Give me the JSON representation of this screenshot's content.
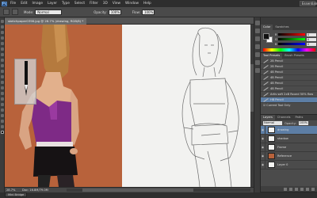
{
  "menubar": {
    "logo": "Ps",
    "items": [
      "File",
      "Edit",
      "Image",
      "Layer",
      "Type",
      "Select",
      "Filter",
      "3D",
      "View",
      "Window",
      "Help"
    ],
    "workspace": "Essentials"
  },
  "options": {
    "mode_label": "Mode:",
    "mode_value": "Normal",
    "opacity_label": "Opacity:",
    "opacity_value": "100%",
    "flow_label": "Flow:",
    "flow_value": "100%"
  },
  "document": {
    "tab_title": "sketchpaper0398.jpg @ 28.7% (drawing, RGB/8) *"
  },
  "status": {
    "zoom": "28.7%",
    "doc_info": "Doc: 16.8M/79.0M"
  },
  "bottom": {
    "mini_bridge": "Mini Bridge"
  },
  "color_panel": {
    "tabs": [
      "Color",
      "Swatches"
    ],
    "sliders": [
      {
        "label": "R",
        "value": "0"
      },
      {
        "label": "G",
        "value": "0"
      },
      {
        "label": "B",
        "value": "0"
      }
    ],
    "colors": {
      "foreground": "#111111",
      "background": "#ffffff"
    }
  },
  "presets_panel": {
    "tabs": [
      "Tool Presets",
      "Brush Presets"
    ],
    "items": [
      "2B Pencil",
      "2B Pencil",
      "4B Pencil",
      "4B Pencil",
      "4B Pencil",
      "4B Pencil",
      "Artis soft 2xB Round 50% flow",
      "HB Pencil"
    ],
    "selected_index": 7,
    "current_only": "Current Tool Only"
  },
  "layers_panel": {
    "tabs": [
      "Layers",
      "Channels",
      "Paths"
    ],
    "blend_mode": "Normal",
    "opacity_label": "Opacity:",
    "opacity_value": "100%",
    "layers": [
      {
        "name": "drawing",
        "selected": true,
        "thumb": "white"
      },
      {
        "name": "shadow",
        "selected": false,
        "thumb": "white"
      },
      {
        "name": "Frame",
        "selected": false,
        "thumb": "white"
      },
      {
        "name": "Reference",
        "selected": false,
        "thumb": "orange"
      },
      {
        "name": "Layer 0",
        "selected": false,
        "thumb": "white"
      }
    ]
  }
}
